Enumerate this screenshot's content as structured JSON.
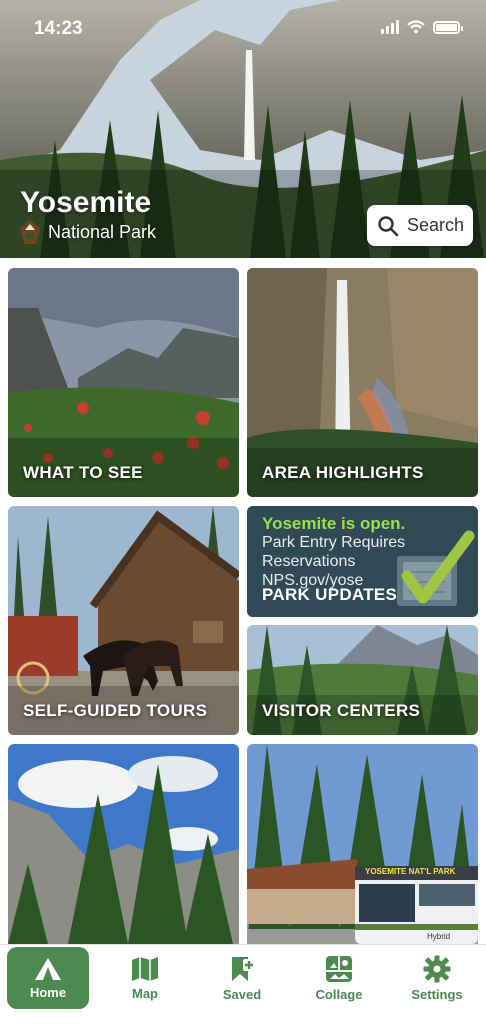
{
  "status_bar": {
    "time": "14:23"
  },
  "header": {
    "title": "Yosemite",
    "subtitle": "National Park",
    "search_label": "Search"
  },
  "tiles": [
    {
      "label": "WHAT TO SEE"
    },
    {
      "label": "AREA HIGHLIGHTS"
    },
    {
      "label": "SELF-GUIDED TOURS"
    },
    {
      "label": "PARK UPDATES",
      "lines": [
        "Yosemite is open.",
        "Park Entry Requires",
        "Reservations",
        "NPS.gov/yose"
      ]
    },
    {
      "label": "VISITOR CENTERS"
    },
    {
      "label": ""
    },
    {
      "label": "",
      "bus_sign": "YOSEMITE NAT'L PARK",
      "bus_side": "Hybrid"
    }
  ],
  "tabbar": {
    "items": [
      {
        "label": "Home",
        "icon": "home-tent-icon",
        "active": true
      },
      {
        "label": "Map",
        "icon": "map-icon",
        "active": false
      },
      {
        "label": "Saved",
        "icon": "bookmark-plus-icon",
        "active": false
      },
      {
        "label": "Collage",
        "icon": "collage-icon",
        "active": false
      },
      {
        "label": "Settings",
        "icon": "gear-icon",
        "active": false
      }
    ]
  },
  "colors": {
    "accent": "#4c8a50",
    "updates_bg": "#2f4a55",
    "open_green": "#9be04a"
  }
}
